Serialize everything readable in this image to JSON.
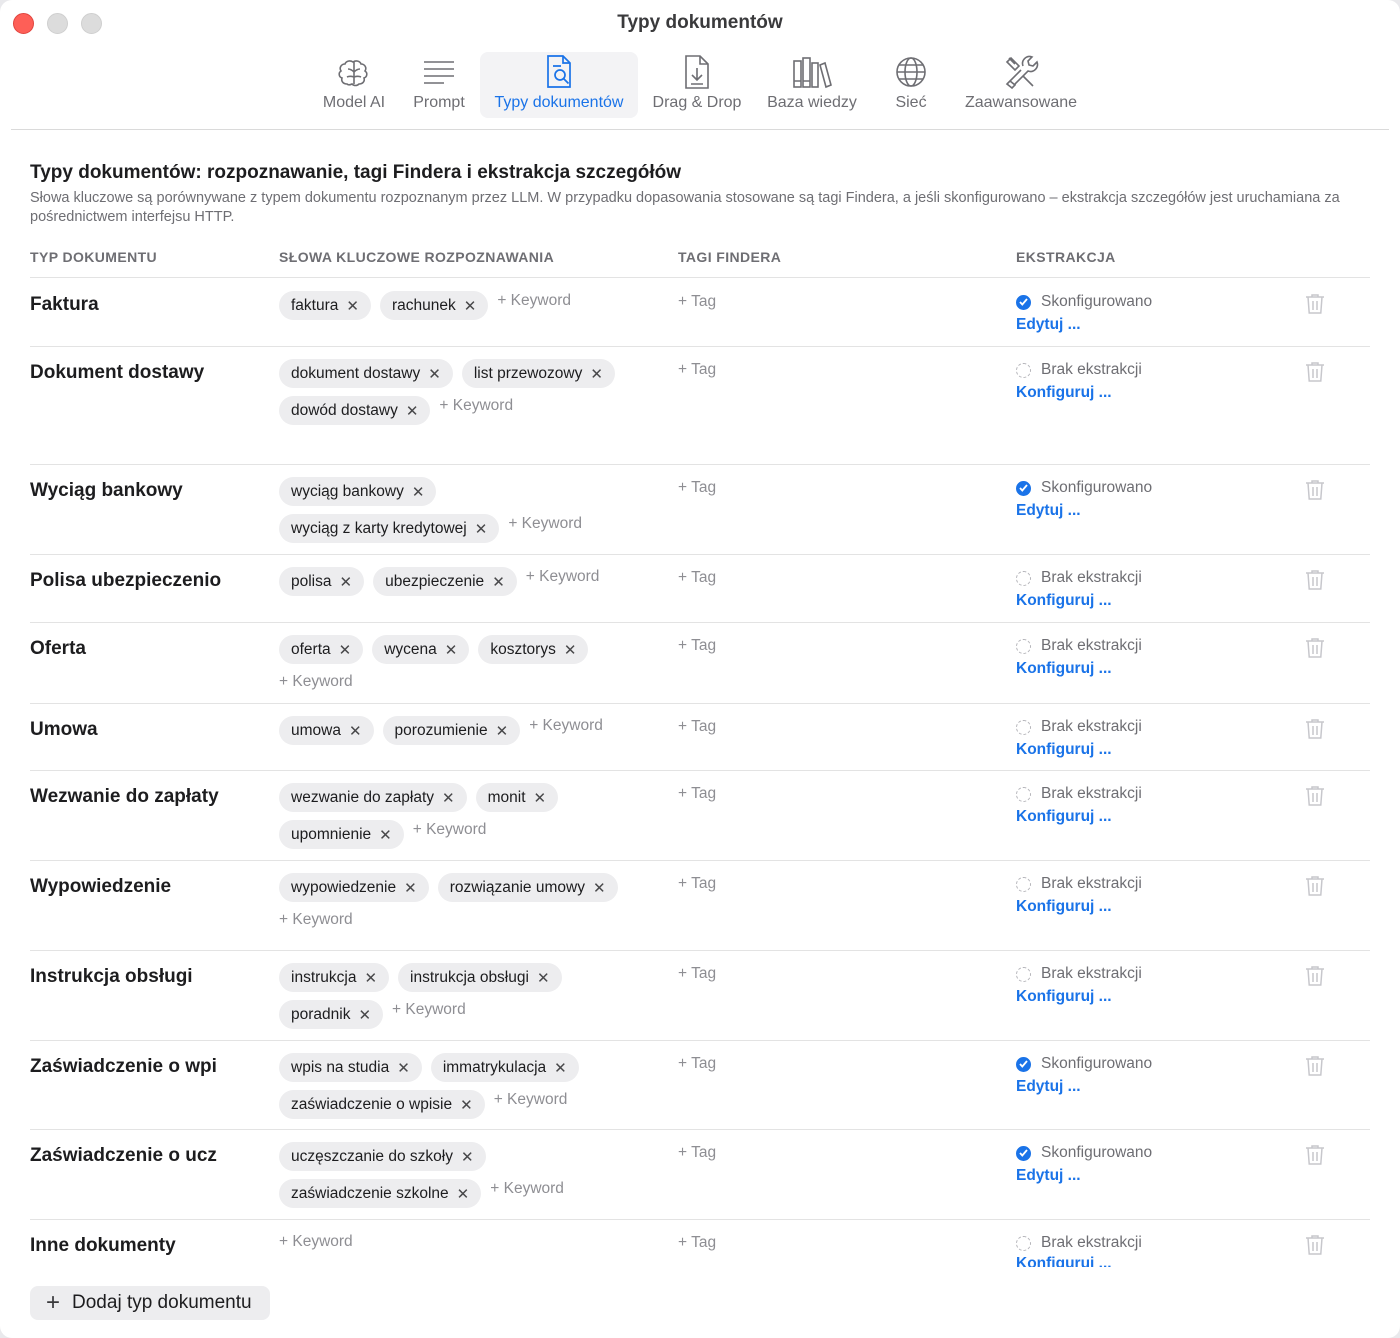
{
  "window": {
    "title": "Typy dokumentów"
  },
  "toolbar": [
    {
      "label": "Model AI",
      "icon": "brain-icon",
      "active": false
    },
    {
      "label": "Prompt",
      "icon": "text-lines-icon",
      "active": false
    },
    {
      "label": "Typy dokumentów",
      "icon": "document-search-icon",
      "active": true
    },
    {
      "label": "Drag & Drop",
      "icon": "document-download-icon",
      "active": false
    },
    {
      "label": "Baza wiedzy",
      "icon": "books-icon",
      "active": false
    },
    {
      "label": "Sieć",
      "icon": "globe-icon",
      "active": false
    },
    {
      "label": "Zaawansowane",
      "icon": "tools-icon",
      "active": false
    }
  ],
  "section": {
    "title": "Typy dokumentów: rozpoznawanie, tagi Findera i ekstrakcja szczegółów",
    "description": "Słowa kluczowe są porównywane z typem dokumentu rozpoznanym przez LLM. W przypadku dopasowania stosowane są tagi Findera, a jeśli skonfigurowano – ekstrakcja szczegółów jest uruchamiana za pośrednictwem interfejsu HTTP."
  },
  "table": {
    "headers": {
      "type": "TYP DOKUMENTU",
      "keywords": "SŁOWA KLUCZOWE ROZPOZNAWANIA",
      "tags": "TAGI FINDERA",
      "extraction": "EKSTRAKCJA"
    },
    "add_keyword_label": "+ Keyword",
    "add_tag_label": "+ Tag",
    "status_configured": "Skonfigurowano",
    "status_none": "Brak ekstrakcji",
    "link_edit": "Edytuj ...",
    "link_configure": "Konfiguruj ...",
    "rows": [
      {
        "name": "Faktura",
        "keywords": [
          "faktura",
          "rachunek"
        ],
        "configured": true
      },
      {
        "name": "Dokument dostawy",
        "keywords": [
          "dokument dostawy",
          "list przewozowy",
          "dowód dostawy"
        ],
        "configured": false
      },
      {
        "name": "Wyciąg bankowy",
        "keywords": [
          "wyciąg bankowy",
          "wyciąg z karty kredytowej"
        ],
        "configured": true
      },
      {
        "name": "Polisa ubezpieczenio",
        "keywords": [
          "polisa",
          "ubezpieczenie"
        ],
        "configured": false
      },
      {
        "name": "Oferta",
        "keywords": [
          "oferta",
          "wycena",
          "kosztorys"
        ],
        "configured": false
      },
      {
        "name": "Umowa",
        "keywords": [
          "umowa",
          "porozumienie"
        ],
        "configured": false
      },
      {
        "name": "Wezwanie do zapłaty",
        "keywords": [
          "wezwanie do zapłaty",
          "monit",
          "upomnienie"
        ],
        "configured": false
      },
      {
        "name": "Wypowiedzenie",
        "keywords": [
          "wypowiedzenie",
          "rozwiązanie umowy"
        ],
        "configured": false
      },
      {
        "name": "Instrukcja obsługi",
        "keywords": [
          "instrukcja",
          "instrukcja obsługi",
          "poradnik"
        ],
        "configured": false
      },
      {
        "name": "Zaświadczenie o wpi",
        "keywords": [
          "wpis na studia",
          "immatrykulacja",
          "zaświadczenie o wpisie"
        ],
        "configured": true
      },
      {
        "name": "Zaświadczenie o ucz",
        "keywords": [
          "uczęszczanie do szkoły",
          "zaświadczenie szkolne"
        ],
        "configured": true
      },
      {
        "name": "Inne dokumenty",
        "keywords": [],
        "configured": false
      }
    ]
  },
  "add_type_button": {
    "label": "Dodaj typ dokumentu"
  }
}
